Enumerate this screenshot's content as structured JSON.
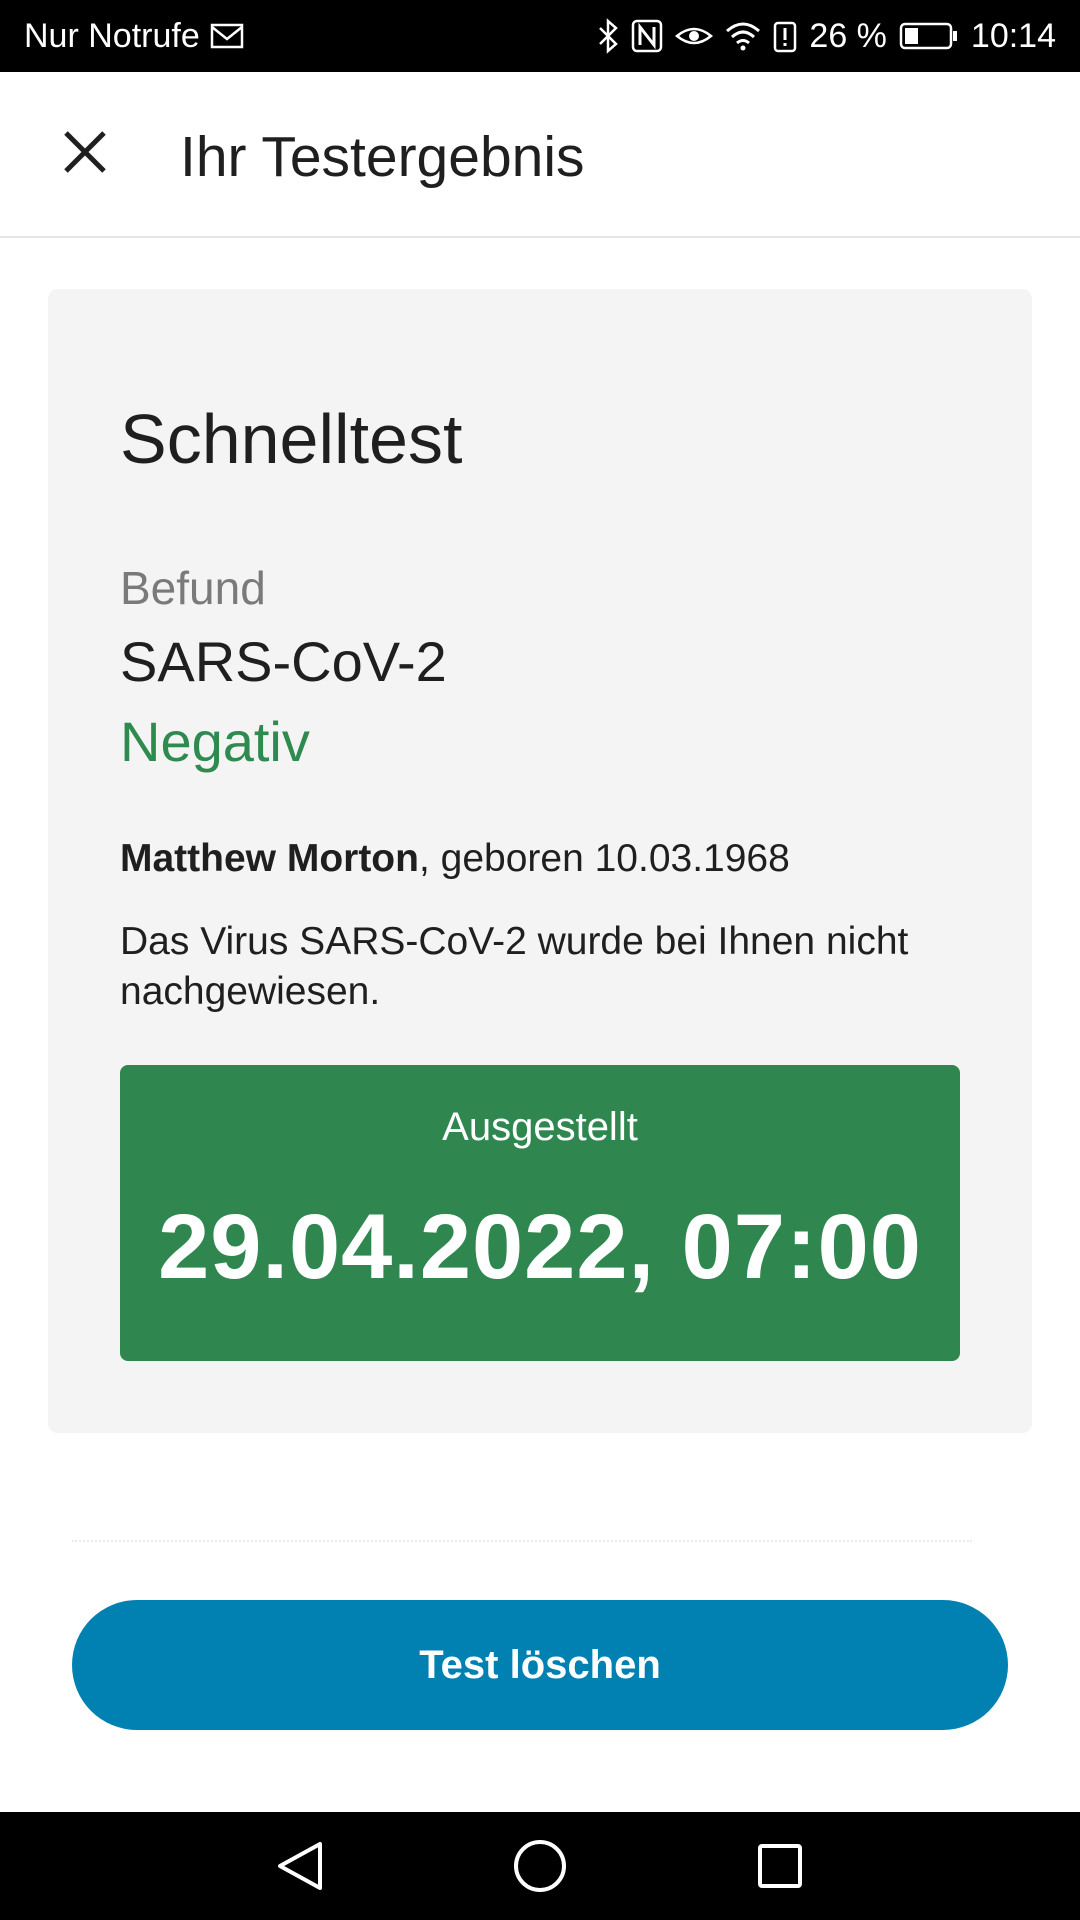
{
  "status_bar": {
    "carrier": "Nur Notrufe",
    "battery_percent": "26 %",
    "time": "10:14",
    "icons": [
      "mail-icon",
      "bluetooth-icon",
      "nfc-icon",
      "eye-comfort-icon",
      "wifi-icon",
      "alert-icon",
      "battery-icon"
    ]
  },
  "app_bar": {
    "title": "Ihr Testergebnis",
    "close_icon": "close-icon"
  },
  "card": {
    "title": "Schnelltest",
    "finding_label": "Befund",
    "pathogen": "SARS-CoV-2",
    "result": "Negativ",
    "person_name": "Matthew Morton",
    "birth_text": ", geboren 10.03.1968",
    "result_text": "Das Virus SARS-CoV-2 wurde bei Ihnen nicht nachgewiesen.",
    "issued_label": "Ausgestellt",
    "issued_datetime": "29.04.2022, 07:00"
  },
  "actions": {
    "delete_label": "Test löschen"
  },
  "nav_bar": {
    "icons": [
      "back-icon",
      "home-icon",
      "recents-icon"
    ]
  },
  "colors": {
    "accent_blue": "#0081b2",
    "success_green": "#2e8a4f",
    "issued_box_green": "#2f874f",
    "card_background": "#f4f4f4"
  }
}
